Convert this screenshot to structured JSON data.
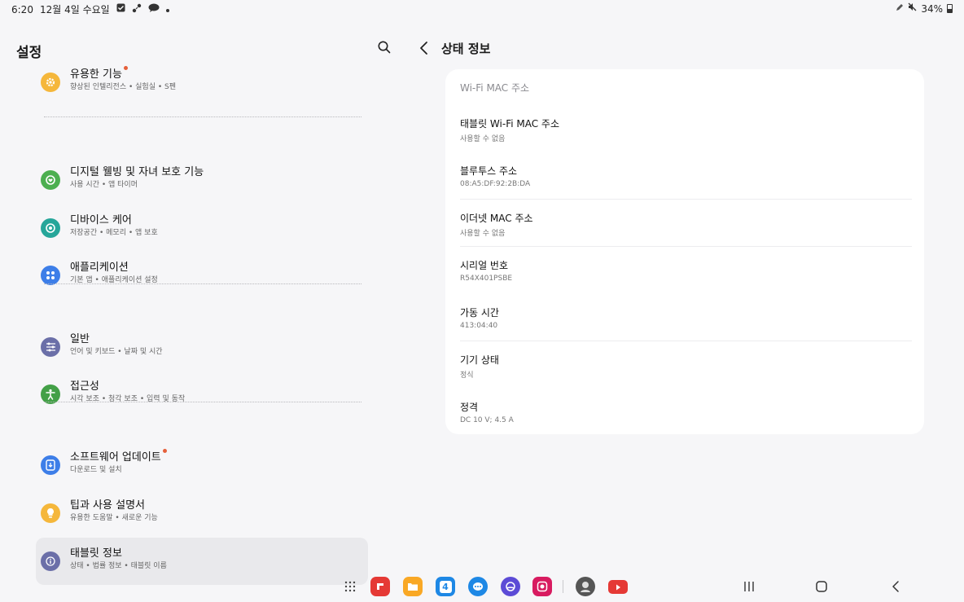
{
  "status_bar": {
    "time": "6:20",
    "date": "12월 4일 수요일",
    "battery": "34%",
    "icons": [
      "checkbox-icon",
      "apps-icon",
      "chat-bubble-icon",
      "dot-icon",
      "pen-icon",
      "mute-icon",
      "battery-icon"
    ]
  },
  "left_panel": {
    "title": "설정",
    "search_icon": "search-icon",
    "items": [
      {
        "title": "유용한 기능",
        "sub": "향상된 인텔리전스 • 실험실 • S펜",
        "icon": "gear-icon",
        "color": "#f5b73b",
        "badge": true
      },
      {
        "title": "디지털 웰빙 및 자녀 보호 기능",
        "sub": "사용 시간 • 앱 타이머",
        "icon": "wellbeing-icon",
        "color": "#4caf50",
        "badge": false
      },
      {
        "title": "디바이스 케어",
        "sub": "저장공간 • 메모리 • 앱 보호",
        "icon": "device-care-icon",
        "color": "#26a69a",
        "badge": false
      },
      {
        "title": "애플리케이션",
        "sub": "기본 앱 • 애플리케이션 설정",
        "icon": "apps-grid-icon",
        "color": "#3d7ee8",
        "badge": false
      },
      {
        "title": "일반",
        "sub": "언어 및 키보드 • 날짜 및 시간",
        "icon": "sliders-icon",
        "color": "#6b6fa8",
        "badge": false
      },
      {
        "title": "접근성",
        "sub": "시각 보조 • 청각 보조 • 입력 및 동작",
        "icon": "accessibility-icon",
        "color": "#43a047",
        "badge": false
      },
      {
        "title": "소프트웨어 업데이트",
        "sub": "다운로드 및 설치",
        "icon": "software-update-icon",
        "color": "#3d7ee8",
        "badge": true
      },
      {
        "title": "팁과 사용 설명서",
        "sub": "유용한 도움말 • 새로운 기능",
        "icon": "lightbulb-icon",
        "color": "#f5b73b",
        "badge": false
      },
      {
        "title": "태블릿 정보",
        "sub": "상태 • 법률 정보 • 태블릿 이름",
        "icon": "info-icon",
        "color": "#6b6fa8",
        "badge": false
      }
    ]
  },
  "right_panel": {
    "title": "상태 정보",
    "back_icon": "chevron-left-icon",
    "header": "Wi-Fi MAC 주소",
    "rows": [
      {
        "title": "태블릿 Wi-Fi MAC 주소",
        "value": "사용할 수 없음"
      },
      {
        "title": "블루투스 주소",
        "value": "08:A5:DF:92:2B:DA"
      },
      {
        "title": "이더넷 MAC 주소",
        "value": "사용할 수 없음"
      },
      {
        "title": "시리얼 번호",
        "value": "R54X401PSBE"
      },
      {
        "title": "가동 시간",
        "value": "413:04:40"
      },
      {
        "title": "기기 상태",
        "value": "정식"
      },
      {
        "title": "정격",
        "value": "DC 10 V; 4.5 A"
      }
    ]
  },
  "taskbar": {
    "apps": [
      {
        "name": "app-drawer-icon",
        "color": "#444444"
      },
      {
        "name": "flipboard-icon",
        "color": "#e53935"
      },
      {
        "name": "my-files-icon",
        "color": "#f9a825"
      },
      {
        "name": "calendar-icon",
        "color": "#1e88e5",
        "label": "4"
      },
      {
        "name": "messages-icon",
        "color": "#1e88e5"
      },
      {
        "name": "internet-icon",
        "color": "#5c4bd6"
      },
      {
        "name": "screen-recorder-icon",
        "color": "#d81b60"
      },
      {
        "name": "game-icon",
        "color": "#555555"
      },
      {
        "name": "youtube-icon",
        "color": "#e53935"
      }
    ],
    "nav": [
      "recents-icon",
      "home-icon",
      "back-icon"
    ]
  }
}
